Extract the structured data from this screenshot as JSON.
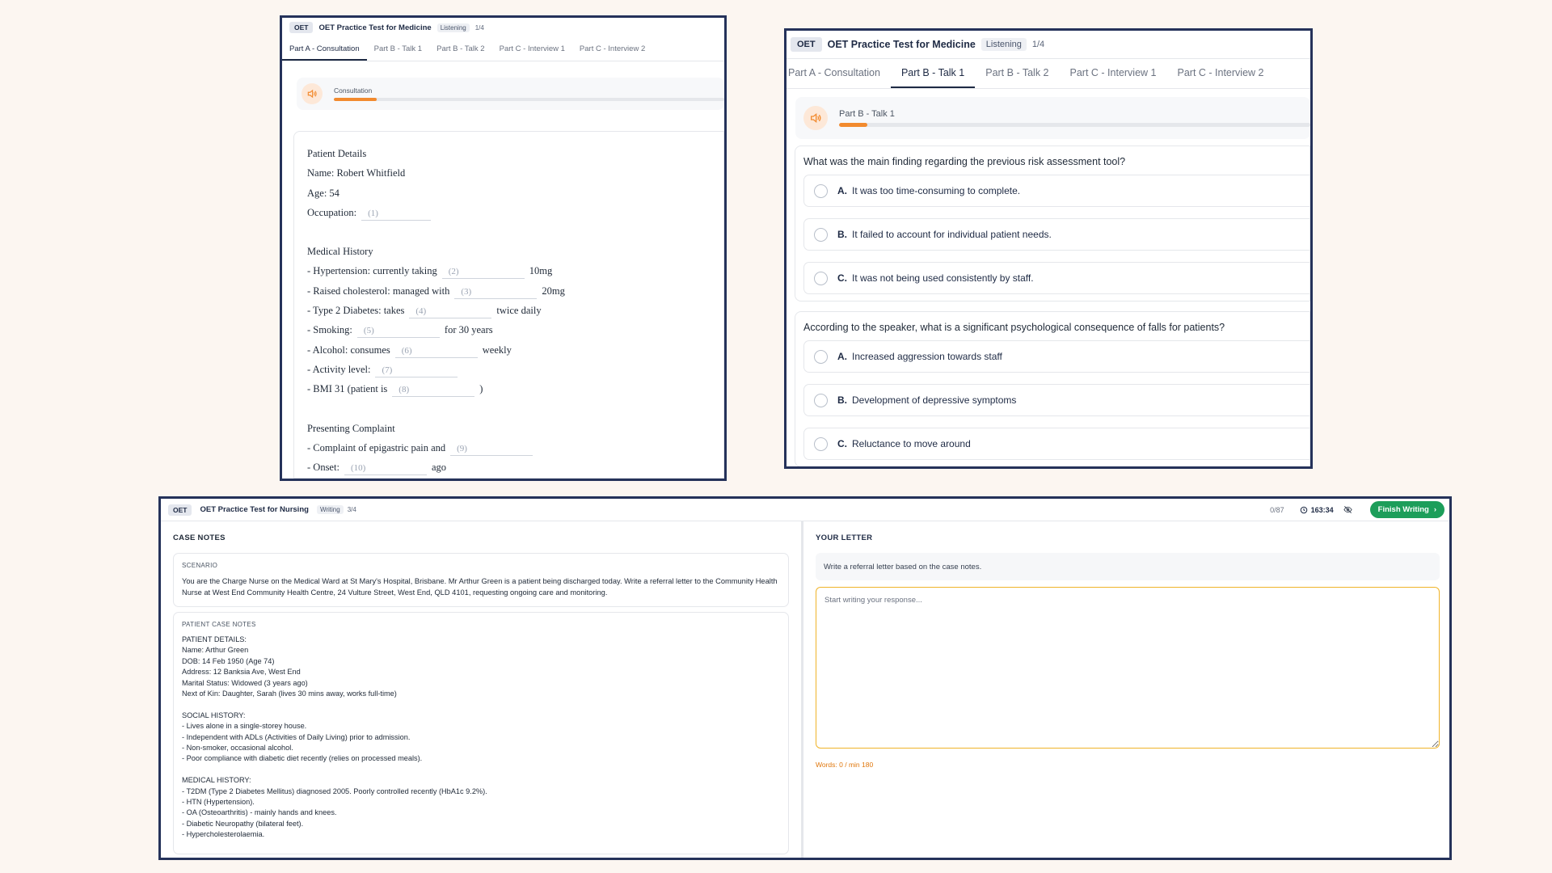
{
  "shot1": {
    "header": {
      "badge": "OET",
      "title": "OET Practice Test for Medicine",
      "mode": "Listening",
      "count": "1/4"
    },
    "tabs": [
      "Part A - Consultation",
      "Part B - Talk 1",
      "Part B - Talk 2",
      "Part C - Interview 1",
      "Part C - Interview 2"
    ],
    "player": {
      "label": "Consultation",
      "progress": 0.11
    },
    "notes": {
      "patient_heading": "Patient Details",
      "name": "Name: Robert Whitfield",
      "age": "Age: 54",
      "occupation_pre": "Occupation:",
      "history_heading": "Medical History",
      "h1_pre": "- Hypertension: currently taking",
      "h1_post": "10mg",
      "h2_pre": "- Raised cholesterol: managed with",
      "h2_post": "20mg",
      "h3_pre": "- Type 2 Diabetes: takes",
      "h3_post": "twice daily",
      "h4_pre": "- Smoking:",
      "h4_post": "for 30 years",
      "h5_pre": "- Alcohol: consumes",
      "h5_post": "weekly",
      "h6_pre": "- Activity level:",
      "h7_pre": "- BMI 31 (patient is",
      "h7_post": ")",
      "complaint_heading": "Presenting Complaint",
      "c1_pre": "- Complaint of epigastric pain and",
      "c2_pre": "- Onset:",
      "c2_post": "ago",
      "blanks": [
        "(1)",
        "(2)",
        "(3)",
        "(4)",
        "(5)",
        "(6)",
        "(7)",
        "(8)",
        "(9)",
        "(10)"
      ]
    }
  },
  "shot2": {
    "header": {
      "badge": "OET",
      "title": "OET Practice Test for Medicine",
      "mode": "Listening",
      "count": "1/4"
    },
    "tabs": [
      "Part A - Consultation",
      "Part B - Talk 1",
      "Part B - Talk 2",
      "Part C - Interview 1",
      "Part C - Interview 2"
    ],
    "player": {
      "label": "Part B - Talk 1",
      "progress": 0.06
    },
    "questions": [
      {
        "text": "What was the main finding regarding the previous risk assessment tool?",
        "options": [
          {
            "letter": "A.",
            "text": "It was too time-consuming to complete."
          },
          {
            "letter": "B.",
            "text": "It failed to account for individual patient needs."
          },
          {
            "letter": "C.",
            "text": "It was not being used consistently by staff."
          }
        ]
      },
      {
        "text": "According to the speaker, what is a significant psychological consequence of falls for patients?",
        "options": [
          {
            "letter": "A.",
            "text": "Increased aggression towards staff"
          },
          {
            "letter": "B.",
            "text": "Development of depressive symptoms"
          },
          {
            "letter": "C.",
            "text": "Reluctance to move around"
          }
        ]
      }
    ]
  },
  "shot3": {
    "header": {
      "badge": "OET",
      "title": "OET Practice Test for Nursing",
      "mode": "Writing",
      "count": "3/4",
      "word_count": "0/87",
      "timer": "163:34",
      "finish_label": "Finish Writing"
    },
    "left": {
      "heading": "CASE NOTES",
      "scenario_title": "SCENARIO",
      "scenario": "You are the Charge Nurse on the Medical Ward at St Mary's Hospital, Brisbane. Mr Arthur Green is a patient being discharged today. Write a referral letter to the Community Health Nurse at West End Community Health Centre, 24 Vulture Street, West End, QLD 4101, requesting ongoing care and monitoring.",
      "notes_title": "PATIENT CASE NOTES",
      "lines": [
        "PATIENT DETAILS:",
        "Name: Arthur Green",
        "DOB: 14 Feb 1950 (Age 74)",
        "Address: 12 Banksia Ave, West End",
        "Marital Status: Widowed (3 years ago)",
        "Next of Kin: Daughter, Sarah (lives 30 mins away, works full-time)",
        "",
        "SOCIAL HISTORY:",
        "- Lives alone in a single-storey house.",
        "- Independent with ADLs (Activities of Daily Living) prior to admission.",
        "- Non-smoker, occasional alcohol.",
        "- Poor compliance with diabetic diet recently (relies on processed meals).",
        "",
        "MEDICAL HISTORY:",
        "- T2DM (Type 2 Diabetes Mellitus) diagnosed 2005. Poorly controlled recently (HbA1c 9.2%).",
        "- HTN (Hypertension).",
        "- OA (Osteoarthritis) - mainly hands and knees.",
        "- Diabetic Neuropathy (bilateral feet).",
        "- Hypercholesterolaemia."
      ]
    },
    "right": {
      "heading": "YOUR LETTER",
      "instruction": "Write a referral letter based on the case notes.",
      "placeholder": "Start writing your response...",
      "words": "Words: 0 / min 180"
    }
  },
  "colors": {
    "accent_orange": "#f28a2e",
    "frame": "#25325a",
    "finish_green": "#1d9e5a",
    "textarea_border": "#f0b429"
  }
}
